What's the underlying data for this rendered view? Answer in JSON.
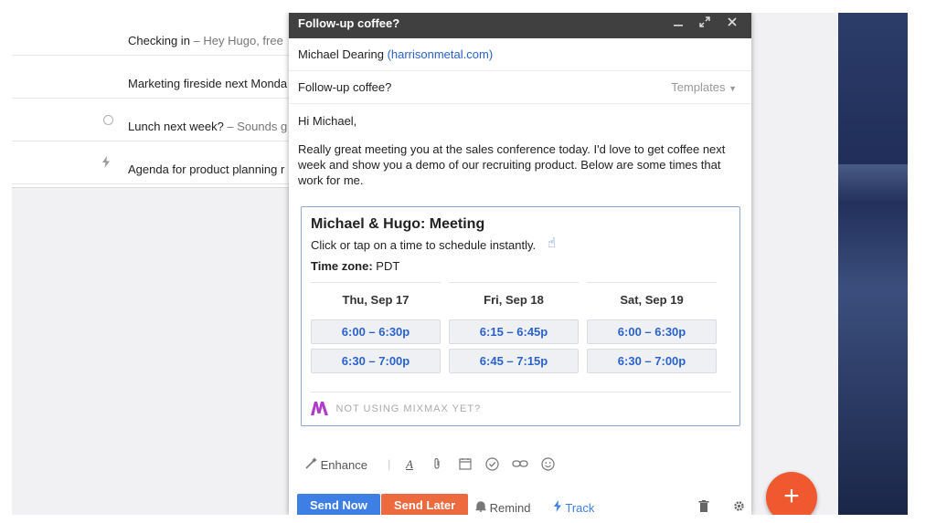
{
  "inbox": {
    "rows": [
      {
        "subject": "Checking in",
        "snippet": " – Hey Hugo, free",
        "icon": ""
      },
      {
        "subject": "Marketing fireside next Monda",
        "snippet": "",
        "icon": ""
      },
      {
        "subject": "Lunch next week?",
        "snippet": " – Sounds g",
        "icon": "circle-icon"
      },
      {
        "subject": "Agenda for product planning r",
        "snippet": "",
        "icon": "lightning-icon"
      }
    ]
  },
  "compose": {
    "window_title": "Follow-up coffee?",
    "to_name": "Michael Dearing",
    "to_domain": "(harrisonmetal.com)",
    "subject": "Follow-up coffee?",
    "templates_label": "Templates",
    "greeting": "Hi Michael,",
    "body": "Really great meeting you at the sales conference today. I'd love to get coffee next week and show you a demo of our recruiting product. Below are some times that work for me."
  },
  "meeting": {
    "title": "Michael & Hugo: Meeting",
    "subtitle": "Click or tap on a time to schedule instantly.",
    "timezone_label": "Time zone:",
    "timezone_value": "PDT",
    "days": [
      {
        "label": "Thu, Sep 17",
        "slots": [
          "6:00 – 6:30p",
          "6:30 – 7:00p"
        ]
      },
      {
        "label": "Fri, Sep 18",
        "slots": [
          "6:15 – 6:45p",
          "6:45 – 7:15p"
        ]
      },
      {
        "label": "Sat, Sep 19",
        "slots": [
          "6:00 – 6:30p",
          "6:30 – 7:00p"
        ]
      }
    ],
    "footer": "NOT USING MIXMAX YET?",
    "brand_color": "#b03cc9"
  },
  "toolbar": {
    "enhance_label": "Enhance",
    "icons": [
      "font-icon",
      "attach-icon",
      "calendar-icon",
      "check-circle-icon",
      "link-icon",
      "emoji-icon"
    ]
  },
  "actions": {
    "send_now": "Send Now",
    "send_later": "Send Later",
    "remind": "Remind",
    "track": "Track",
    "send_color": "#3e7fe6",
    "later_color": "#ec6a3e"
  },
  "fab": {
    "label": "+",
    "color": "#f0592f"
  }
}
